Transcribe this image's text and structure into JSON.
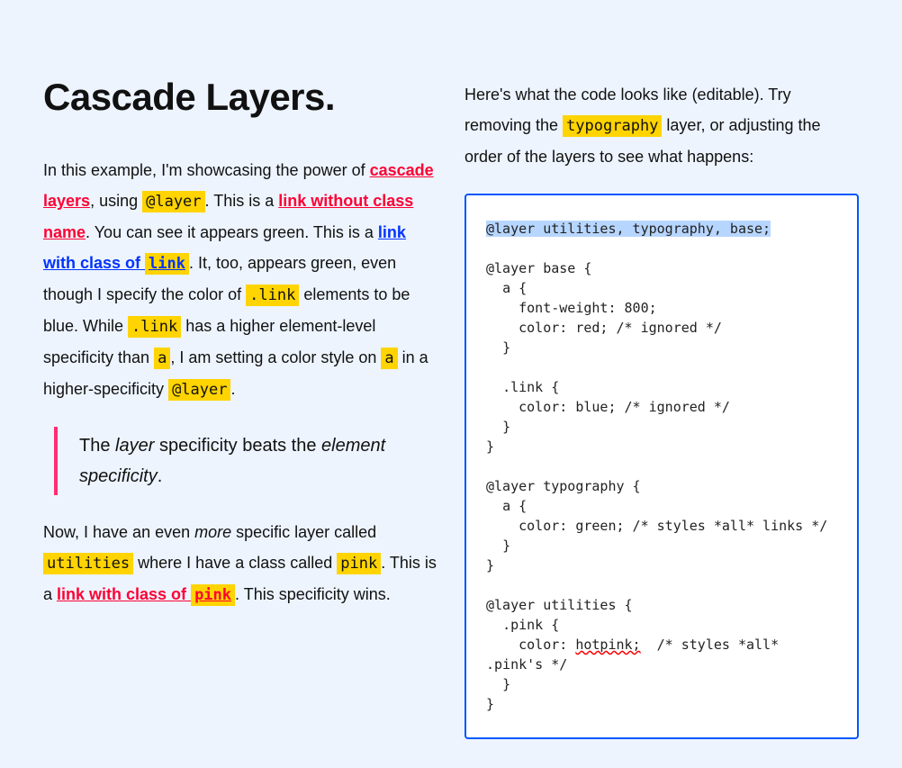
{
  "left": {
    "title": "Cascade Layers.",
    "p1": {
      "t1": "In this example, I'm showcasing the power of ",
      "link_cascade": "cascade layers",
      "t2": ", using ",
      "code_layer": "@layer",
      "t3": ". This is a ",
      "link_noclass": "link without class name",
      "t4": ". You can see it appears green. This is a ",
      "link_withclass_text": "link with class of ",
      "link_withclass_code": "link",
      "t5": ". It, too, appears green, even though I specify the color of ",
      "code_dotlink1": ".link",
      "t6": " elements to be blue. While  ",
      "code_dotlink2": ".link",
      "t7": " has a higher element-level specificity than ",
      "code_a1": "a",
      "t8": ", I am setting a color style on ",
      "code_a2": "a",
      "t9": " in a higher-specificity ",
      "code_layer2": "@layer",
      "t10": "."
    },
    "blockquote": {
      "a": "The ",
      "b": "layer",
      "c": " specificity beats the ",
      "d": "element specificity",
      "e": "."
    },
    "p2": {
      "t1": "Now, I have an even ",
      "em": "more",
      "t2": " specific layer called ",
      "code_util": "utilities",
      "t3": " where I have a class called ",
      "code_pink": "pink",
      "t4": ". This is a ",
      "link_pink_text": "link with class of ",
      "link_pink_code": "pink",
      "t5": ". This specificity wins."
    }
  },
  "right": {
    "intro": {
      "t1": "Here's what the code looks like (editable). Try removing the ",
      "code": "typography",
      "t2": " layer, or adjusting the order of the layers to see what happens:"
    },
    "editor": {
      "selected": "@layer utilities, typography, base;",
      "gap1": "\n\n",
      "l1": "@layer base {\n  a {\n    font-weight: 800;\n    color: red; /* ignored */\n  }\n\n  .link {\n    color: blue; /* ignored */\n  }\n}\n\n@layer typography {\n  a {\n    color: green; /* styles *all* links */\n  }\n}\n\n@layer utilities {\n  .pink {\n    color: ",
      "squiggle": "hotpink;",
      "l2": "  /* styles *all* .pink's */\n  }\n}"
    }
  }
}
